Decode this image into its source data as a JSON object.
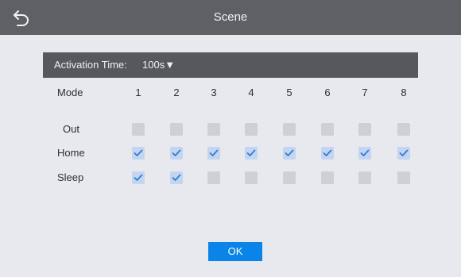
{
  "header": {
    "title": "Scene",
    "back_icon": "back-arrow-icon"
  },
  "activation": {
    "label": "Activation Time:",
    "value": "100s▼"
  },
  "table": {
    "mode_label": "Mode",
    "columns": [
      "1",
      "2",
      "3",
      "4",
      "5",
      "6",
      "7",
      "8"
    ],
    "rows": [
      {
        "label": "Out",
        "checked": [
          false,
          false,
          false,
          false,
          false,
          false,
          false,
          false
        ]
      },
      {
        "label": "Home",
        "checked": [
          true,
          true,
          true,
          true,
          true,
          true,
          true,
          true
        ]
      },
      {
        "label": "Sleep",
        "checked": [
          true,
          true,
          false,
          false,
          false,
          false,
          false,
          false
        ]
      }
    ]
  },
  "footer": {
    "ok_label": "OK"
  },
  "colors": {
    "titlebar": "#5e6066",
    "panel": "#56585d",
    "accent": "#0a84e8",
    "check": "#2f7be0"
  }
}
